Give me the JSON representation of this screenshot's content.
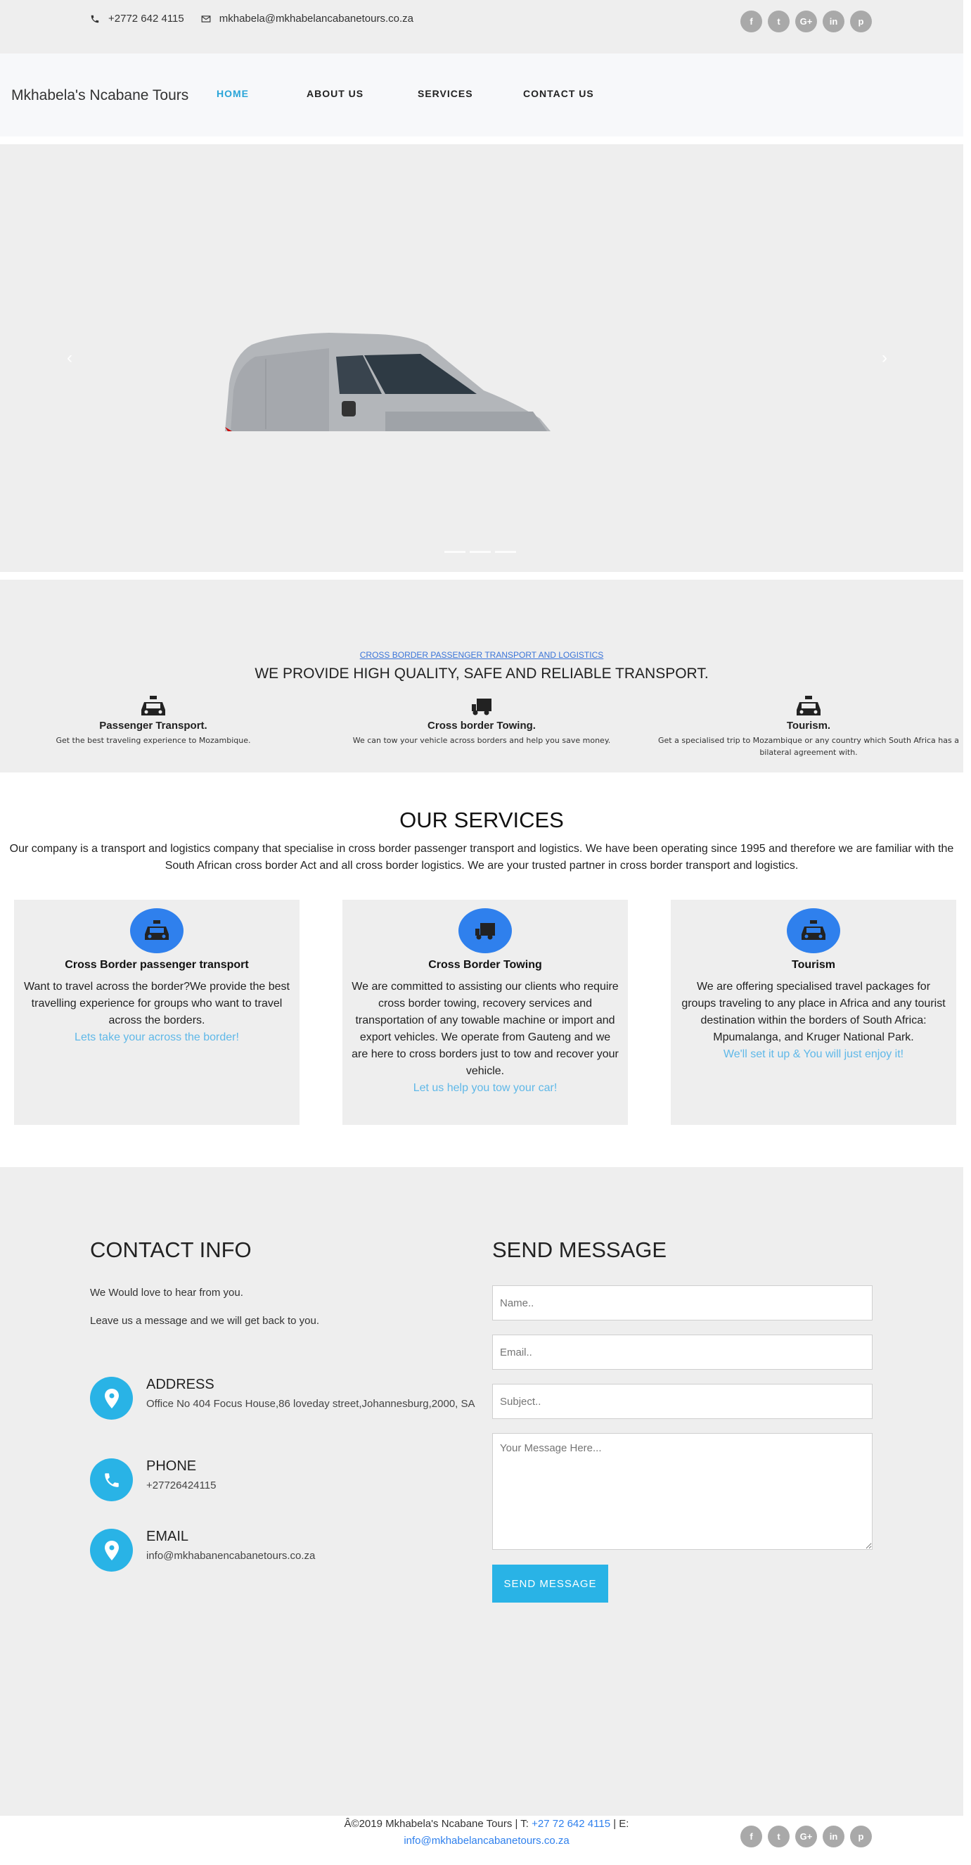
{
  "topbar": {
    "phone": "+2772 642 4115",
    "email": "mkhabela@mkhabelancabanetours.co.za",
    "social": [
      "f",
      "t",
      "G+",
      "in",
      "p"
    ]
  },
  "nav": {
    "brand": "Mkhabela's Ncabane Tours",
    "links": [
      "HOME",
      "ABOUT US",
      "SERVICES",
      "CONTACT US"
    ]
  },
  "hero": {
    "prev_icon": "chevron-left-icon",
    "next_icon": "chevron-right-icon",
    "prev_glyph": "‹",
    "next_glyph": "›"
  },
  "features": {
    "tag": "CROSS BORDER PASSENGER TRANSPORT AND LOGISTICS",
    "heading": "WE PROVIDE HIGH QUALITY, SAFE AND RELIABLE TRANSPORT.",
    "items": [
      {
        "icon": "taxi-icon",
        "title": "Passenger Transport.",
        "desc": "Get the best traveling experience to Mozambique."
      },
      {
        "icon": "truck-icon",
        "title": "Cross border Towing.",
        "desc": "We can tow your vehicle across borders and help you save money."
      },
      {
        "icon": "taxi-icon",
        "title": "Tourism.",
        "desc": "Get a specialised trip to Mozambique or any country which South Africa has a bilateral agreement with."
      }
    ]
  },
  "services": {
    "title": "OUR SERVICES",
    "intro": "Our company is a transport and logistics company that specialise in cross border passenger transport and logistics. We have been operating since 1995 and therefore we are familiar with the South African cross border Act and all cross border logistics. We are your trusted partner in cross border transport and logistics.",
    "cards": [
      {
        "icon": "taxi-icon",
        "title": "Cross Border passenger transport",
        "desc": "Want to travel across the border?We provide the best travelling experience for groups who want to travel across the borders.",
        "link": "Lets take your across the border!"
      },
      {
        "icon": "truck-icon",
        "title": "Cross Border Towing",
        "desc": "We are committed to assisting our clients who require cross border towing, recovery services and transportation of any towable machine or import and export vehicles. We operate from Gauteng and we are here to cross borders just to tow and recover your vehicle.",
        "link": "Let us help you tow your car!"
      },
      {
        "icon": "taxi-icon",
        "title": "Tourism",
        "desc": "We are offering specialised travel packages for groups traveling to any place in Africa and any tourist destination within the borders of South Africa: Mpumalanga, and Kruger National Park.",
        "link": "We'll set it up & You will just enjoy it!"
      }
    ]
  },
  "contact": {
    "title": "CONTACT INFO",
    "p1": "We Would love to hear from you.",
    "p2": "Leave us a message and we will get back to you.",
    "address_label": "ADDRESS",
    "address": "Office No 404 Focus House,86 loveday street,Johannesburg,2000, SA",
    "phone_label": "PHONE",
    "phone": "+27726424115",
    "email_label": "EMAIL",
    "email": "info@mkhabanencabanetours.co.za"
  },
  "form": {
    "title": "SEND MESSAGE",
    "name_placeholder": "Name..",
    "email_placeholder": "Email..",
    "subject_placeholder": "Subject..",
    "message_placeholder": "Your Message Here...",
    "submit": "SEND MESSAGE"
  },
  "footer": {
    "text_a": "Â©2019 Mkhabela's Ncabane Tours | T: ",
    "phone": "+27 72 642 4115",
    "text_b": " | E:",
    "email": "info@mkhabelancabanetours.co.za",
    "social": [
      "f",
      "t",
      "G+",
      "in",
      "p"
    ]
  },
  "colors": {
    "accent": "#29b3e6",
    "nav_active": "#2aa5d8",
    "service_icon_bg": "#2f80ed",
    "link": "#5fb8e8",
    "section_bg": "#eeeeee"
  }
}
